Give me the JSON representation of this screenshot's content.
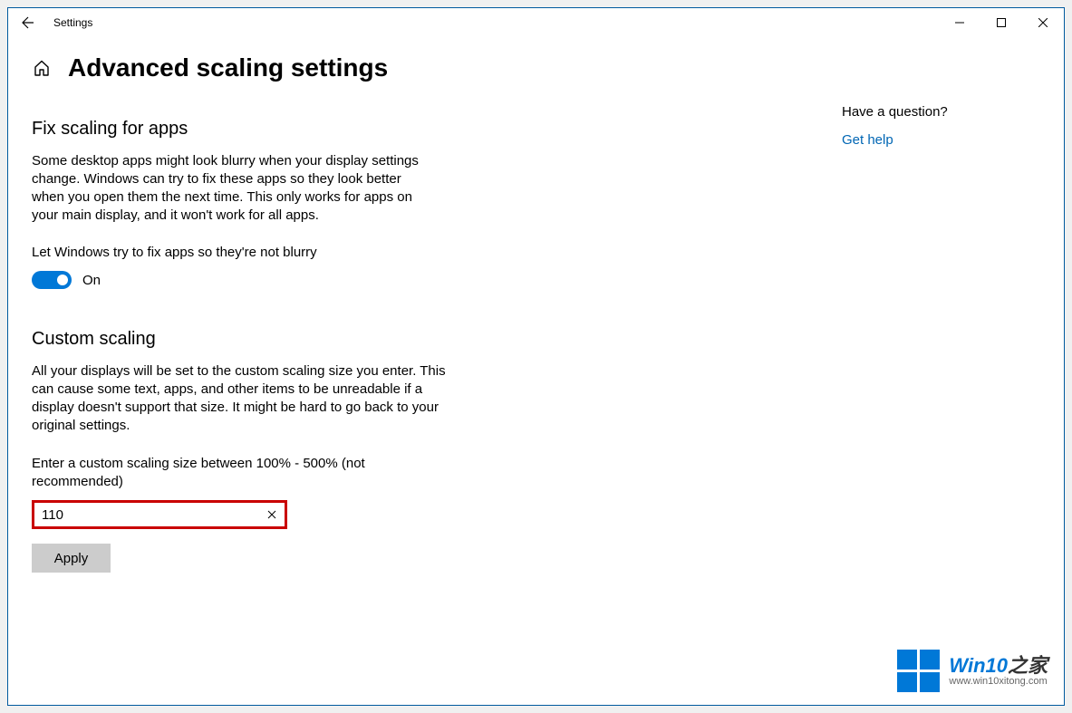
{
  "window": {
    "title": "Settings"
  },
  "page": {
    "title": "Advanced scaling settings"
  },
  "fixScaling": {
    "heading": "Fix scaling for apps",
    "description": "Some desktop apps might look blurry when your display settings change. Windows can try to fix these apps so they look better when you open them the next time. This only works for apps on your main display, and it won't work for all apps.",
    "toggleLabel": "Let Windows try to fix apps so they're not blurry",
    "toggleState": "On"
  },
  "customScaling": {
    "heading": "Custom scaling",
    "description": "All your displays will be set to the custom scaling size you enter. This can cause some text, apps, and other items to be unreadable if a display doesn't support that size. It might be hard to go back to your original settings.",
    "inputLabel": "Enter a custom scaling size between 100% - 500% (not recommended)",
    "inputValue": "110",
    "applyLabel": "Apply"
  },
  "sidebar": {
    "questionHeading": "Have a question?",
    "helpLink": "Get help"
  },
  "watermark": {
    "title_pre": "Win10",
    "title_post": "之家",
    "url": "www.win10xitong.com"
  }
}
